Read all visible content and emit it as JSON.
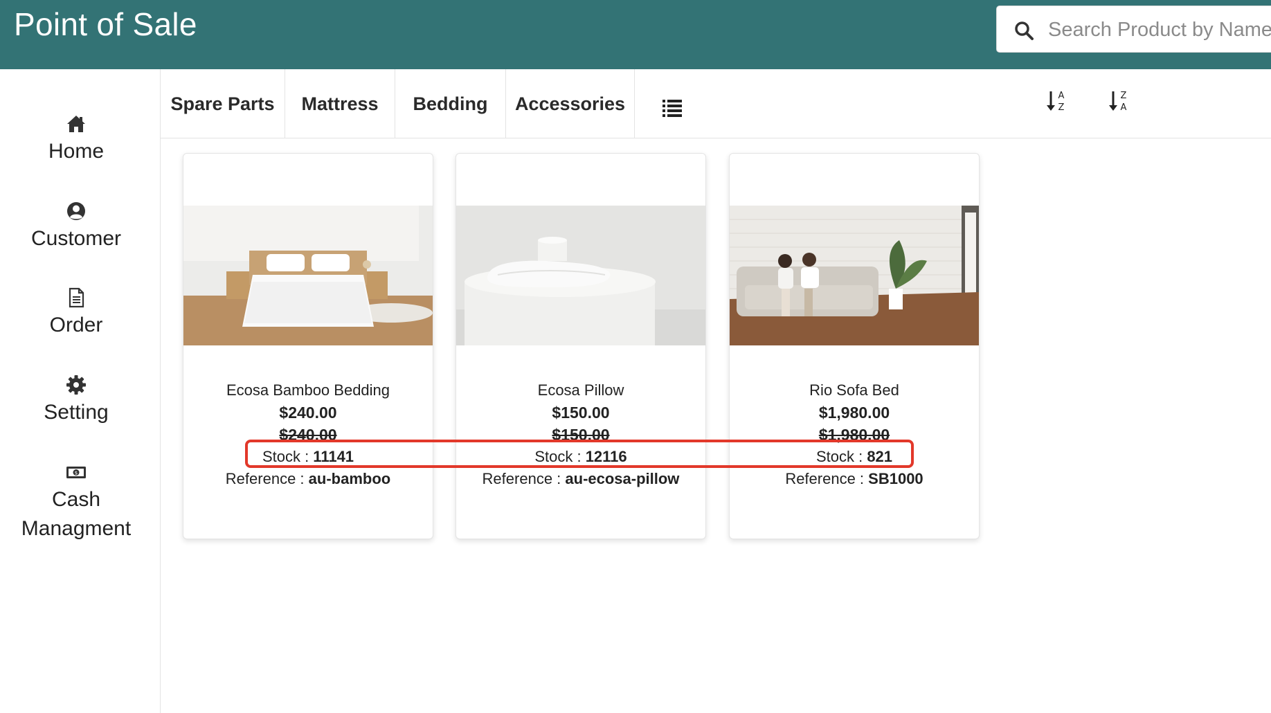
{
  "header": {
    "title": "Point of Sale",
    "search_placeholder": "Search Product by Name, Reference"
  },
  "sidebar": {
    "items": [
      {
        "label": "Home",
        "icon": "home-icon"
      },
      {
        "label": "Customer",
        "icon": "user-circle-icon"
      },
      {
        "label": "Order",
        "icon": "document-icon"
      },
      {
        "label": "Setting",
        "icon": "gear-icon"
      },
      {
        "label_line1": "Cash",
        "label_line2": "Managment",
        "icon": "cash-icon"
      }
    ]
  },
  "categories": {
    "tabs": [
      "Spare Parts",
      "Mattress",
      "Bedding",
      "Accessories"
    ],
    "list_icon": "list-icon",
    "sort_icons": [
      "sort-a-z-icon",
      "sort-z-a-icon"
    ]
  },
  "products": [
    {
      "name": "Ecosa Bamboo Bedding",
      "price": "$240.00",
      "old_price": "$240.00",
      "stock_label": "Stock : ",
      "stock": "11141",
      "ref_label": "Reference : ",
      "reference": "au-bamboo",
      "image": "bedroom-bed-photo"
    },
    {
      "name": "Ecosa Pillow",
      "price": "$150.00",
      "old_price": "$150.00",
      "stock_label": "Stock : ",
      "stock": "12116",
      "ref_label": "Reference : ",
      "reference": "au-ecosa-pillow",
      "image": "pillow-photo"
    },
    {
      "name": "Rio Sofa Bed",
      "price": "$1,980.00",
      "old_price": "$1,980.00",
      "stock_label": "Stock : ",
      "stock": "821",
      "ref_label": "Reference : ",
      "reference": "SB1000",
      "image": "sofa-couple-photo"
    }
  ],
  "colors": {
    "header_bg": "#337375",
    "highlight": "#e2382a"
  }
}
